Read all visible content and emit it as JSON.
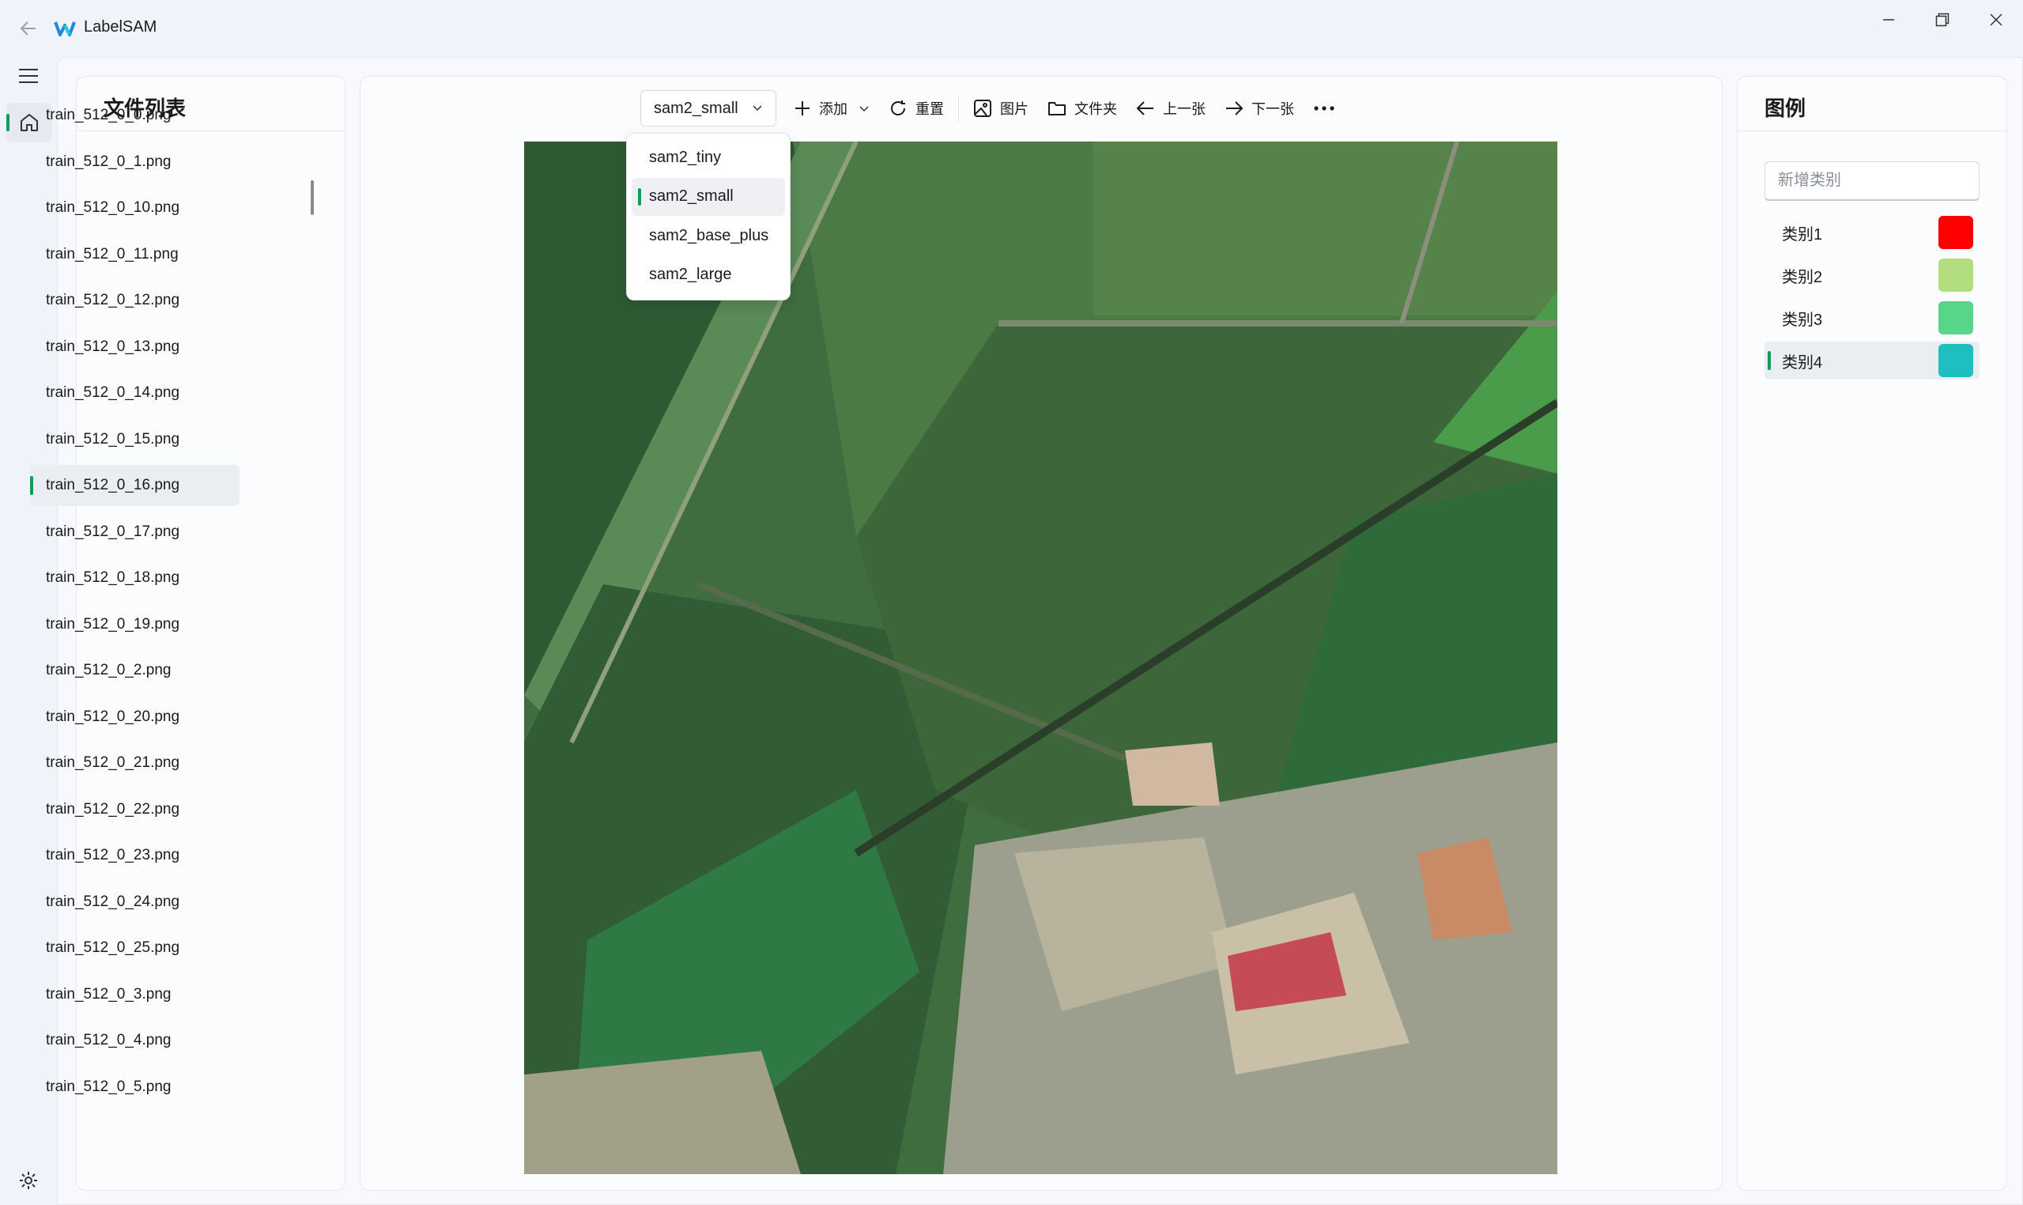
{
  "window": {
    "title": "LabelSAM",
    "back_icon": "arrow-left-icon",
    "logo_icon": "labelsam-logo-icon"
  },
  "nav": {
    "menu_icon": "hamburger-menu-icon",
    "home_icon": "home-icon",
    "settings_icon": "gear-icon"
  },
  "file_panel": {
    "title": "文件列表",
    "selected_index": 8,
    "files": [
      "train_512_0_0.png",
      "train_512_0_1.png",
      "train_512_0_10.png",
      "train_512_0_11.png",
      "train_512_0_12.png",
      "train_512_0_13.png",
      "train_512_0_14.png",
      "train_512_0_15.png",
      "train_512_0_16.png",
      "train_512_0_17.png",
      "train_512_0_18.png",
      "train_512_0_19.png",
      "train_512_0_2.png",
      "train_512_0_20.png",
      "train_512_0_21.png",
      "train_512_0_22.png",
      "train_512_0_23.png",
      "train_512_0_24.png",
      "train_512_0_25.png",
      "train_512_0_3.png",
      "train_512_0_4.png",
      "train_512_0_5.png"
    ]
  },
  "toolbar": {
    "model_selected": "sam2_small",
    "add_label": "添加",
    "reset_label": "重置",
    "image_label": "图片",
    "folder_label": "文件夹",
    "prev_label": "上一张",
    "next_label": "下一张"
  },
  "model_dropdown": {
    "selected_index": 1,
    "options": [
      "sam2_tiny",
      "sam2_small",
      "sam2_base_plus",
      "sam2_large"
    ]
  },
  "legend_panel": {
    "title": "图例",
    "new_category_placeholder": "新增类别",
    "selected_index": 3,
    "categories": [
      {
        "name": "类别1",
        "color": "#ff0000"
      },
      {
        "name": "类别2",
        "color": "#b3de7f"
      },
      {
        "name": "类别3",
        "color": "#57d68a"
      },
      {
        "name": "类别4",
        "color": "#1fbfbf"
      }
    ]
  },
  "accent_color": "#0f9d58"
}
